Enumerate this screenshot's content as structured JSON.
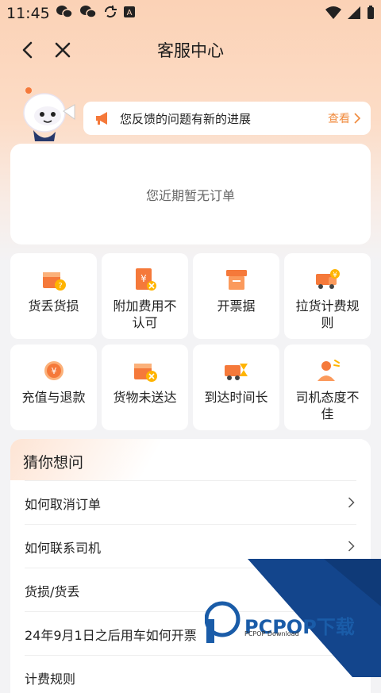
{
  "status": {
    "time": "11:45"
  },
  "nav": {
    "title": "客服中心"
  },
  "notice": {
    "text": "您反馈的问题有新的进展",
    "link": "查看"
  },
  "orders": {
    "empty_text": "您近期暂无订单"
  },
  "services": [
    {
      "label": "货丢货损",
      "icon": "box-question-icon"
    },
    {
      "label": "附加费用不认可",
      "icon": "receipt-yen-icon"
    },
    {
      "label": "开票据",
      "icon": "invoice-printer-icon"
    },
    {
      "label": "拉货计费规则",
      "icon": "truck-yen-icon"
    },
    {
      "label": "充值与退款",
      "icon": "coin-refund-icon"
    },
    {
      "label": "货物未送达",
      "icon": "box-x-icon"
    },
    {
      "label": "到达时间长",
      "icon": "truck-hourglass-icon"
    },
    {
      "label": "司机态度不佳",
      "icon": "driver-attitude-icon"
    }
  ],
  "faq": {
    "title": "猜你想问",
    "items": [
      {
        "q": "如何取消订单"
      },
      {
        "q": "如何联系司机"
      },
      {
        "q": "货损/货丢"
      },
      {
        "q": "24年9月1日之后用车如何开票"
      },
      {
        "q": "计费规则"
      }
    ]
  },
  "watermark": {
    "text": "PCPOP下载",
    "sub": "PCPOP Download"
  },
  "colors": {
    "accent": "#f08a3c",
    "icon_orange": "#f5793a",
    "watermark_blue": "#1a5ca8"
  }
}
